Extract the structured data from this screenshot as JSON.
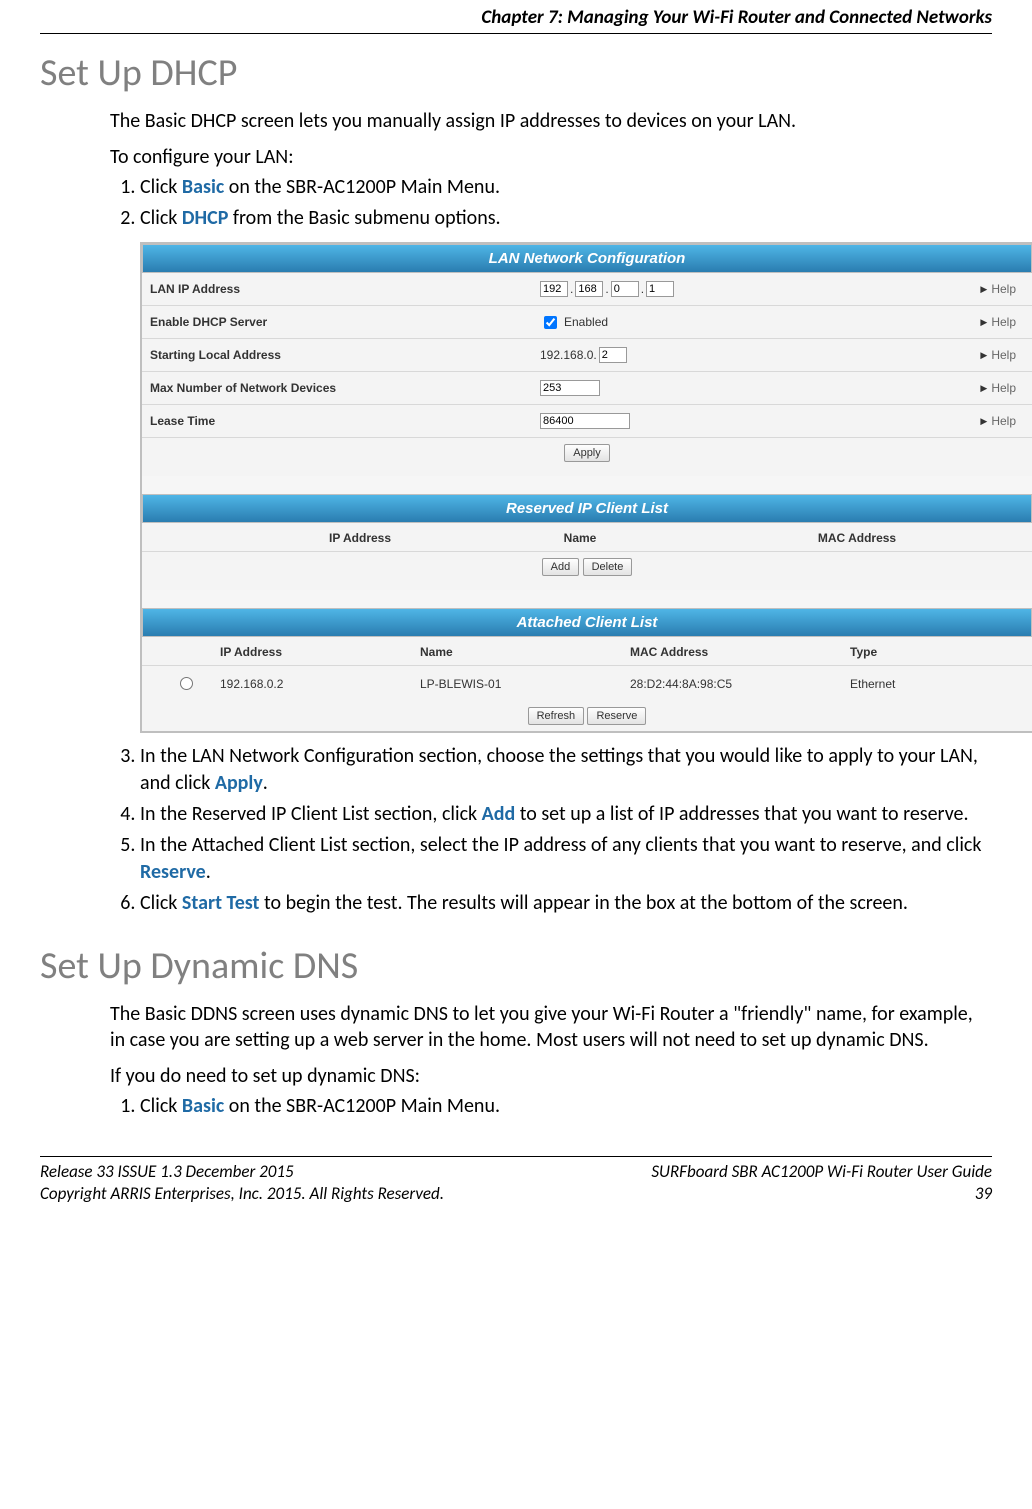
{
  "chapter_header": "Chapter 7: Managing Your Wi-Fi Router and Connected Networks",
  "section1": {
    "title": "Set Up DHCP",
    "intro": "The Basic DHCP screen lets you manually assign IP addresses to devices on your LAN.",
    "lead": "To configure your LAN:",
    "step1_pre": "Click ",
    "step1_kw": "Basic",
    "step1_post": " on the SBR-AC1200P Main Menu.",
    "step2_pre": "Click ",
    "step2_kw": "DHCP",
    "step2_post": " from the Basic submenu options.",
    "step3_pre": "In the LAN Network Configuration section, choose the settings that you would like to apply to your LAN, and click ",
    "step3_kw": "Apply",
    "step3_post": ".",
    "step4_pre": "In the Reserved IP Client List section, click ",
    "step4_kw": "Add",
    "step4_post": " to set up a list of IP addresses that you want to reserve.",
    "step5_pre": "In the Attached Client List section, select the IP address of any clients that you want to reserve, and click ",
    "step5_kw": "Reserve",
    "step5_post": ".",
    "step6_pre": "Click ",
    "step6_kw": "Start Test",
    "step6_post": " to begin the test.  The results will appear in the box at the bottom of the screen."
  },
  "section2": {
    "title": "Set Up Dynamic DNS",
    "intro": "The Basic DDNS screen uses dynamic DNS to let you give your Wi-Fi Router a \"friendly\" name, for example, in case you are setting up a web server in the home.  Most users will not need to set up dynamic DNS.",
    "lead": "If you do need to set up dynamic DNS:",
    "step1_pre": "Click ",
    "step1_kw": "Basic",
    "step1_post": " on the SBR-AC1200P Main Menu."
  },
  "ui": {
    "panel1_title": "LAN Network Configuration",
    "help_label": "Help",
    "rows": {
      "lan_ip": {
        "label": "LAN IP Address",
        "oct1": "192",
        "oct2": "168",
        "oct3": "0",
        "oct4": "1"
      },
      "dhcp": {
        "label": "Enable DHCP Server",
        "enabled_text": "Enabled"
      },
      "start": {
        "label": "Starting Local Address",
        "prefix": "192.168.0.",
        "val": "2"
      },
      "max": {
        "label": "Max Number of Network Devices",
        "val": "253"
      },
      "lease": {
        "label": "Lease Time",
        "val": "86400"
      }
    },
    "apply_btn": "Apply",
    "panel2_title": "Reserved IP Client List",
    "reserved_cols": {
      "ip": "IP Address",
      "name": "Name",
      "mac": "MAC Address"
    },
    "add_btn": "Add",
    "delete_btn": "Delete",
    "panel3_title": "Attached Client List",
    "attached_cols": {
      "ip": "IP Address",
      "name": "Name",
      "mac": "MAC Address",
      "type": "Type"
    },
    "attached_row": {
      "ip": "192.168.0.2",
      "name": "LP-BLEWIS-01",
      "mac": "28:D2:44:8A:98:C5",
      "type": "Ethernet"
    },
    "refresh_btn": "Refresh",
    "reserve_btn": "Reserve"
  },
  "footer": {
    "left1": "Release 33 ISSUE 1.3    December 2015",
    "left2": "Copyright ARRIS Enterprises, Inc. 2015. All Rights Reserved.",
    "right1": "SURFboard SBR AC1200P Wi-Fi Router User Guide",
    "right2": "39"
  }
}
